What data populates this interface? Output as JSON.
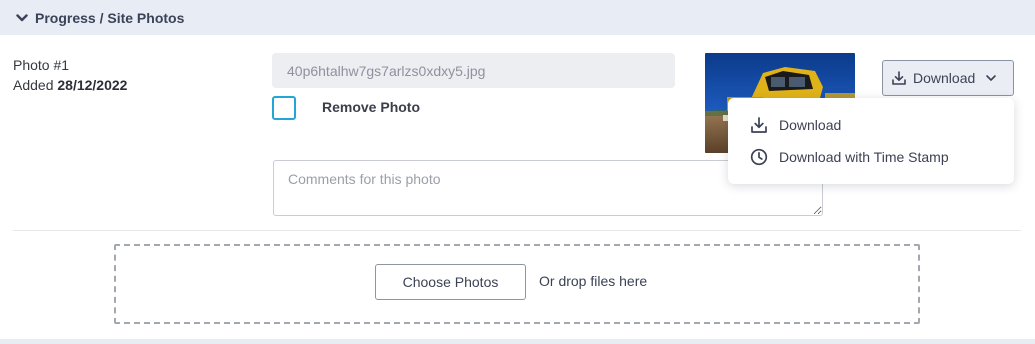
{
  "section": {
    "title": "Progress / Site Photos",
    "expanded": true
  },
  "photo": {
    "number_label": "Photo #1",
    "added_prefix": "Added",
    "added_date": "28/12/2022",
    "filename": "40p6htalhw7gs7arlzs0xdxy5.jpg",
    "remove_label": "Remove Photo",
    "remove_checked": false,
    "comments_placeholder": "Comments for this photo",
    "comments_value": ""
  },
  "download": {
    "button_label": "Download",
    "menu": [
      {
        "label": "Download",
        "icon": "download-icon"
      },
      {
        "label": "Download with Time Stamp",
        "icon": "clock-icon"
      }
    ]
  },
  "upload": {
    "choose_label": "Choose Photos",
    "drop_text": "Or drop files here"
  },
  "colors": {
    "header_bg": "#e8ecf5",
    "checkbox_border": "#23a6d5",
    "text": "#3b4254"
  }
}
